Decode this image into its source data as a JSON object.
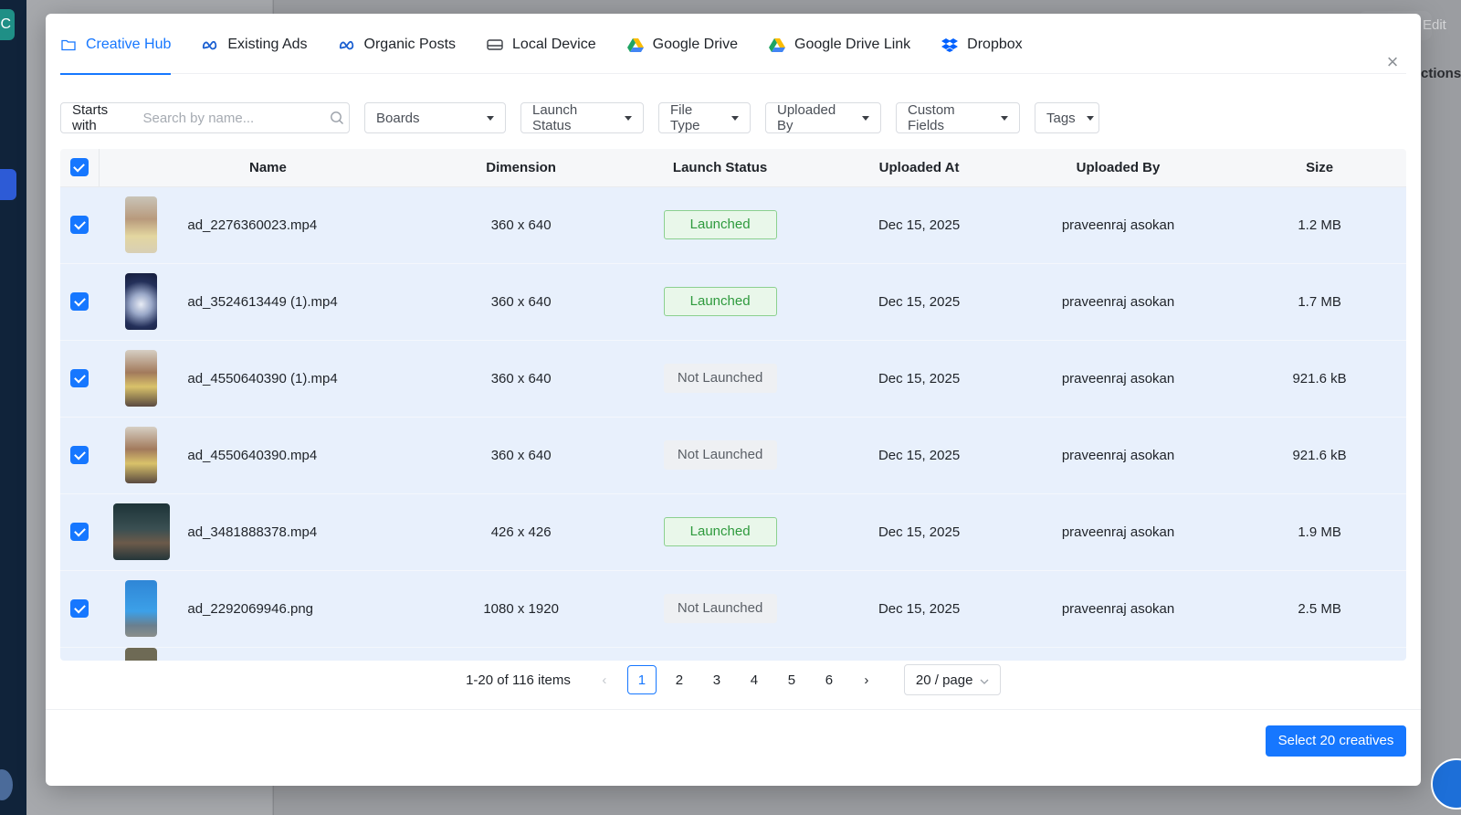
{
  "background": {
    "logo_letter": "C",
    "edit_label": "Edit",
    "actions_label": "ctions"
  },
  "tabs": [
    {
      "label": "Creative Hub",
      "icon": "folder-icon",
      "active": true
    },
    {
      "label": "Existing Ads",
      "icon": "meta-icon",
      "active": false
    },
    {
      "label": "Organic Posts",
      "icon": "meta-icon",
      "active": false
    },
    {
      "label": "Local Device",
      "icon": "hard-drive-icon",
      "active": false
    },
    {
      "label": "Google Drive",
      "icon": "google-drive-icon",
      "active": false
    },
    {
      "label": "Google Drive Link",
      "icon": "google-drive-icon",
      "active": false
    },
    {
      "label": "Dropbox",
      "icon": "dropbox-icon",
      "active": false
    }
  ],
  "filters": {
    "search_prefix": "Starts with",
    "search_placeholder": "Search by name...",
    "boards": "Boards",
    "launch_status": "Launch Status",
    "file_type": "File Type",
    "uploaded_by": "Uploaded By",
    "custom_fields": "Custom Fields",
    "tags": "Tags"
  },
  "table": {
    "columns": {
      "name": "Name",
      "dimension": "Dimension",
      "launch_status": "Launch Status",
      "uploaded_at": "Uploaded At",
      "uploaded_by": "Uploaded By",
      "size": "Size"
    },
    "rows": [
      {
        "name": "ad_2276360023.mp4",
        "dimension": "360 x 640",
        "status": "Launched",
        "uploaded_at": "Dec 15, 2025",
        "uploaded_by": "praveenraj asokan",
        "size": "1.2 MB"
      },
      {
        "name": "ad_3524613449 (1).mp4",
        "dimension": "360 x 640",
        "status": "Launched",
        "uploaded_at": "Dec 15, 2025",
        "uploaded_by": "praveenraj asokan",
        "size": "1.7 MB"
      },
      {
        "name": "ad_4550640390 (1).mp4",
        "dimension": "360 x 640",
        "status": "Not Launched",
        "uploaded_at": "Dec 15, 2025",
        "uploaded_by": "praveenraj asokan",
        "size": "921.6 kB"
      },
      {
        "name": "ad_4550640390.mp4",
        "dimension": "360 x 640",
        "status": "Not Launched",
        "uploaded_at": "Dec 15, 2025",
        "uploaded_by": "praveenraj asokan",
        "size": "921.6 kB"
      },
      {
        "name": "ad_3481888378.mp4",
        "dimension": "426 x 426",
        "status": "Launched",
        "uploaded_at": "Dec 15, 2025",
        "uploaded_by": "praveenraj asokan",
        "size": "1.9 MB"
      },
      {
        "name": "ad_2292069946.png",
        "dimension": "1080 x 1920",
        "status": "Not Launched",
        "uploaded_at": "Dec 15, 2025",
        "uploaded_by": "praveenraj asokan",
        "size": "2.5 MB"
      }
    ]
  },
  "pagination": {
    "total": "1-20 of 116 items",
    "pages": [
      "1",
      "2",
      "3",
      "4",
      "5",
      "6"
    ],
    "current": "1",
    "page_size": "20 / page"
  },
  "footer": {
    "select_button": "Select 20 creatives"
  },
  "colors": {
    "primary": "#1677ff",
    "launched_bg": "#e9f7ea",
    "launched_text": "#2e9a3d",
    "row_selected_bg": "#e8f0fc"
  }
}
